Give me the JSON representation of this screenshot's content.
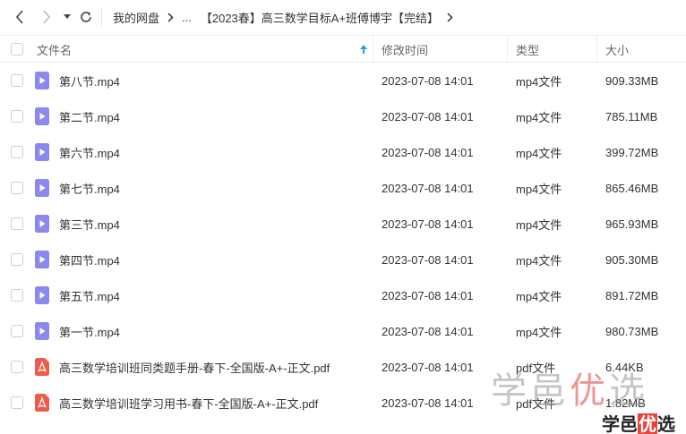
{
  "breadcrumb": {
    "root": "我的网盘",
    "ellipsis": "...",
    "current": "【2023春】高三数学目标A+班傅博宇【完结】"
  },
  "columns": {
    "name": "文件名",
    "modified": "修改时间",
    "type": "类型",
    "size": "大小"
  },
  "files": [
    {
      "name": "第八节.mp4",
      "modified": "2023-07-08 14:01",
      "type": "mp4文件",
      "size": "909.33MB",
      "kind": "video"
    },
    {
      "name": "第二节.mp4",
      "modified": "2023-07-08 14:01",
      "type": "mp4文件",
      "size": "785.11MB",
      "kind": "video"
    },
    {
      "name": "第六节.mp4",
      "modified": "2023-07-08 14:01",
      "type": "mp4文件",
      "size": "399.72MB",
      "kind": "video"
    },
    {
      "name": "第七节.mp4",
      "modified": "2023-07-08 14:01",
      "type": "mp4文件",
      "size": "865.46MB",
      "kind": "video"
    },
    {
      "name": "第三节.mp4",
      "modified": "2023-07-08 14:01",
      "type": "mp4文件",
      "size": "965.93MB",
      "kind": "video"
    },
    {
      "name": "第四节.mp4",
      "modified": "2023-07-08 14:01",
      "type": "mp4文件",
      "size": "905.30MB",
      "kind": "video"
    },
    {
      "name": "第五节.mp4",
      "modified": "2023-07-08 14:01",
      "type": "mp4文件",
      "size": "891.72MB",
      "kind": "video"
    },
    {
      "name": "第一节.mp4",
      "modified": "2023-07-08 14:01",
      "type": "mp4文件",
      "size": "980.73MB",
      "kind": "video"
    },
    {
      "name": "高三数学培训班同类题手册-春下-全国版-A+-正文.pdf",
      "modified": "2023-07-08 14:01",
      "type": "pdf文件",
      "size": "6.44KB",
      "kind": "pdf"
    },
    {
      "name": "高三数学培训班学习用书-春下-全国版-A+-正文.pdf",
      "modified": "2023-07-08 14:01",
      "type": "pdf文件",
      "size": "1.82MB",
      "kind": "pdf"
    }
  ],
  "watermark": {
    "big_a": "学邑",
    "big_b": "优",
    "big_c": "选",
    "small_a": "学邑",
    "small_b": "优",
    "small_c": "选"
  },
  "colors": {
    "video_icon": "#8b88f0",
    "pdf_icon": "#f05a4a",
    "sort_arrow": "#2a9bf0",
    "watermark_accent": "#e8433a"
  },
  "icons": {
    "back": "chevron-left-icon",
    "forward": "chevron-right-icon",
    "dropdown": "caret-down-icon",
    "refresh": "refresh-icon",
    "sort": "sort-arrow-up-icon",
    "video": "video-file-icon",
    "pdf": "pdf-file-icon"
  }
}
